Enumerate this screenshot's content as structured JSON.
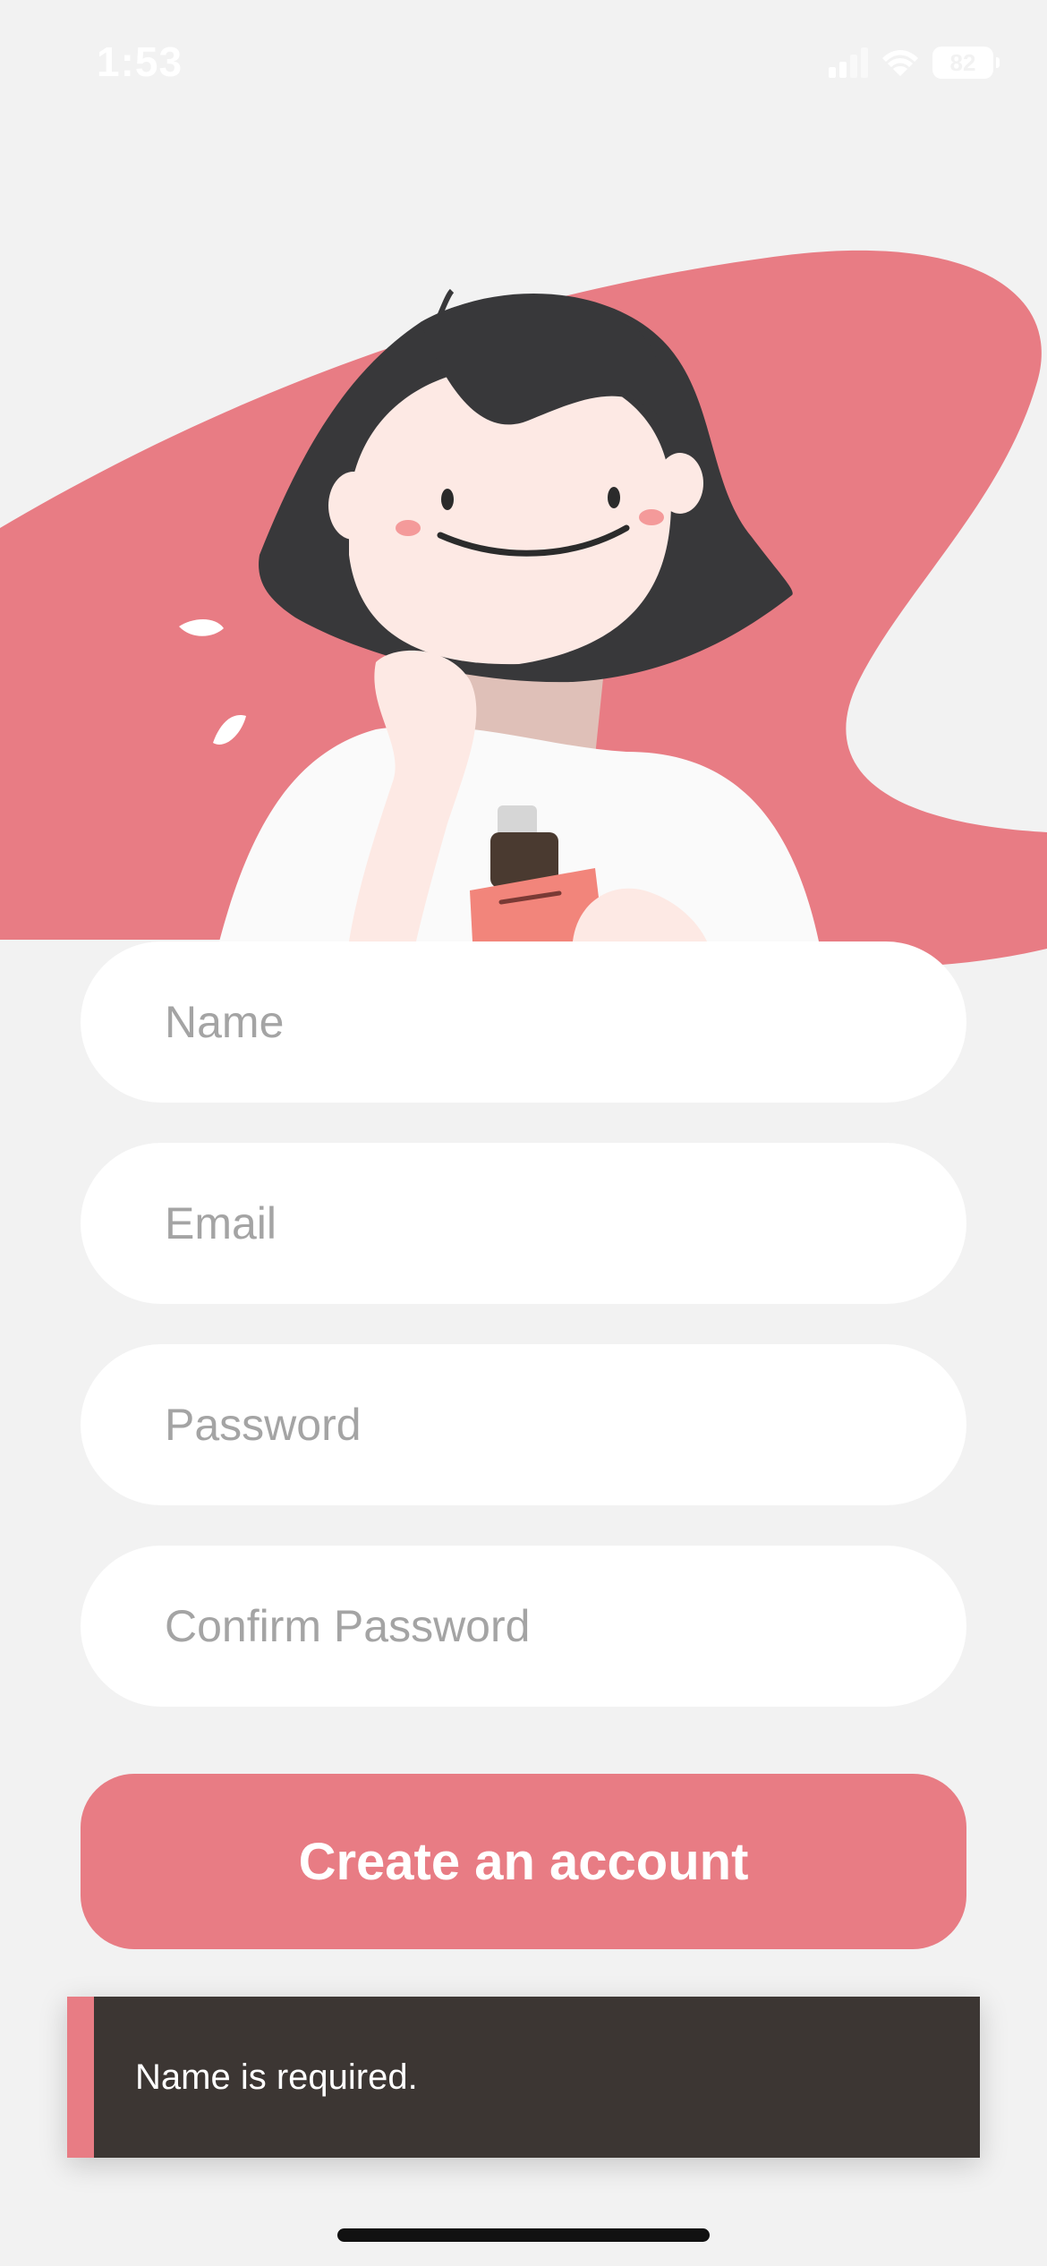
{
  "status_bar": {
    "time": "1:53",
    "battery": "82",
    "icons": [
      "signal-icon",
      "wifi-icon",
      "battery-icon"
    ]
  },
  "illustration": {
    "name": "girl-with-perfume-illustration",
    "colors": {
      "blob": "#e87c84",
      "hair": "#38383a",
      "skin": "#fde9e4",
      "shirt": "#fafafa",
      "bottle": "#f2857b"
    }
  },
  "form": {
    "name_placeholder": "Name",
    "email_placeholder": "Email",
    "password_placeholder": "Password",
    "confirm_password_placeholder": "Confirm Password",
    "name_value": "",
    "email_value": "",
    "password_value": "",
    "confirm_password_value": ""
  },
  "actions": {
    "create_account_label": "Create an account"
  },
  "toast": {
    "message": "Name is required."
  },
  "colors": {
    "accent": "#e87c84",
    "background": "#f2f2f2",
    "toast_background": "#3c3633",
    "placeholder": "#a4a4a4"
  }
}
